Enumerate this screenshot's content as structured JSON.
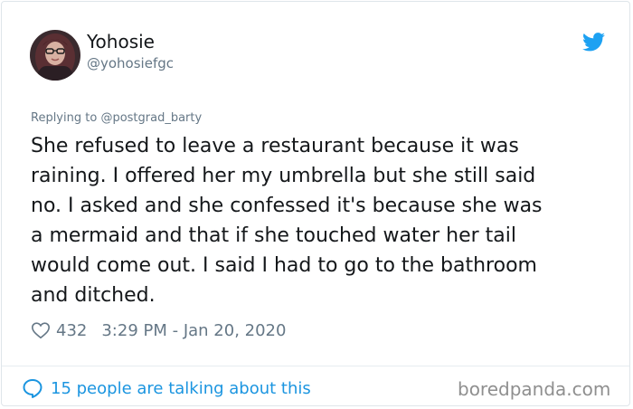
{
  "user": {
    "display_name": "Yohosie",
    "handle": "@yohosiefgc",
    "avatar": "profile-photo"
  },
  "reply": {
    "prefix": "Replying to",
    "mention": "@postgrad_barty"
  },
  "tweet": {
    "lines": [
      "She refused to leave a restaurant because it was",
      "raining. I offered her my umbrella but she still said",
      "no. I asked and she confessed it's because she was",
      "a mermaid and that if she touched water her tail",
      "would come out. I said I had to go to the bathroom",
      "and ditched."
    ]
  },
  "meta": {
    "likes": "432",
    "timestamp": "3:29 PM - Jan 20, 2020"
  },
  "footer": {
    "talking": "15 people are talking about this",
    "watermark": "boredpanda.com"
  },
  "icons": {
    "brand": "twitter-bird-icon",
    "like": "heart-icon",
    "replies": "speech-bubble-icon"
  },
  "colors": {
    "twitter_blue": "#1da1f2",
    "link_blue": "#1b95e0",
    "text": "#14171a",
    "secondary": "#657786"
  }
}
